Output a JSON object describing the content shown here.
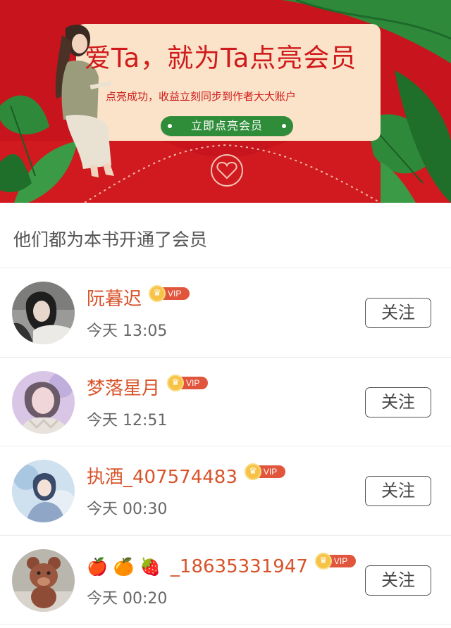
{
  "banner": {
    "headline": "爱Ta，就为Ta点亮会员",
    "subline": "点亮成功，收益立刻同步到作者大大账户",
    "cta_label": "立即点亮会员",
    "colors": {
      "background": "#c8141c",
      "card": "#fbe3c9",
      "cta": "#2f8d3a",
      "text": "#cf1b1b"
    },
    "illustration": "girl-reading-with-leaves-and-heart-envelope"
  },
  "section": {
    "title": "他们都为本书开通了会员"
  },
  "vip_badge": {
    "label": "VIP",
    "icon": "crown-icon"
  },
  "members": [
    {
      "name": "阮暮迟",
      "emoji": "",
      "time": "今天 13:05",
      "follow_label": "关注"
    },
    {
      "name": "梦落星月",
      "emoji": "",
      "time": "今天 12:51",
      "follow_label": "关注"
    },
    {
      "name": "执酒_407574483",
      "emoji": "",
      "time": "今天 00:30",
      "follow_label": "关注"
    },
    {
      "name": "_18635331947",
      "emoji": "🍎 🍊 🍓",
      "time": "今天 00:20",
      "follow_label": "关注"
    }
  ],
  "accent_colors": {
    "username": "#d8532a",
    "vip": "#e0553c",
    "crown": "#f6c347"
  }
}
